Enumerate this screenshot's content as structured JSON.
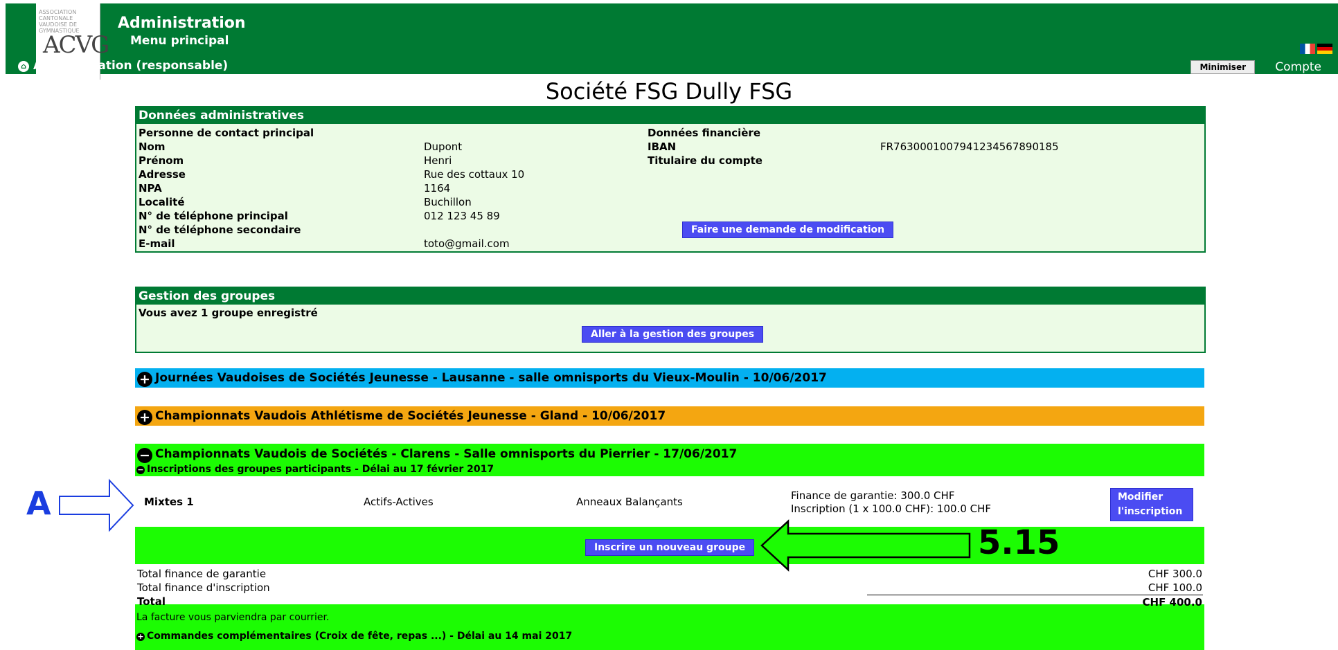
{
  "header": {
    "logo_text": "ACVG",
    "logo_small": "ASSOCIATION CANTONALE VAUDOISE DE GYMNASTIQUE",
    "title": "Administration",
    "subtitle": "Menu principal",
    "home_link": "Administration (responsable)",
    "minimize_label": "Minimiser",
    "account_label": "Compte"
  },
  "page_title": "Société FSG Dully FSG",
  "admin": {
    "heading": "Données administratives",
    "contact_heading": "Personne de contact principal",
    "fields": [
      {
        "label": "Nom",
        "value": "Dupont"
      },
      {
        "label": "Prénom",
        "value": "Henri"
      },
      {
        "label": "Adresse",
        "value": "Rue des cottaux 10"
      },
      {
        "label": "NPA",
        "value": "1164"
      },
      {
        "label": "Localité",
        "value": "Buchillon"
      },
      {
        "label": "N° de téléphone principal",
        "value": "012 123 45 89"
      },
      {
        "label": "N° de téléphone secondaire",
        "value": ""
      },
      {
        "label": "E-mail",
        "value": "toto@gmail.com"
      }
    ],
    "finance_heading": "Données financière",
    "iban_label": "IBAN",
    "iban_value": "FR7630001007941234567890185",
    "holder_label": "Titulaire du compte",
    "modify_button": "Faire une demande de modification"
  },
  "groups": {
    "heading": "Gestion des groupes",
    "count_text": "Vous avez 1 groupe enregistré",
    "button": "Aller à la gestion des groupes"
  },
  "events": [
    {
      "title": "Journées Vaudoises de Sociétés Jeunesse - Lausanne - salle omnisports du Vieux-Moulin - 10/06/2017",
      "color": "#04b0f0",
      "expanded": false
    },
    {
      "title": "Championnats Vaudois Athlétisme de Sociétés Jeunesse - Gland - 10/06/2017",
      "color": "#f4a611",
      "expanded": false
    },
    {
      "title": "Championnats Vaudois de Sociétés - Clarens - Salle omnisports du Pierrier - 17/06/2017",
      "color": "#1cfc03",
      "expanded": true
    }
  ],
  "registrations": {
    "heading": "Inscriptions des groupes participants - Délai au 17 février 2017",
    "entry": {
      "group": "Mixtes 1",
      "category": "Actifs-Actives",
      "discipline": "Anneaux Balançants",
      "guarantee": "Finance de garantie: 300.0 CHF",
      "inscription": "Inscription (1 x 100.0 CHF): 100.0 CHF",
      "modify_button": "Modifier l'inscription"
    },
    "new_group_button": "Inscrire un nouveau groupe"
  },
  "totals": {
    "guarantee_label": "Total finance de garantie",
    "guarantee_value": "CHF 300.0",
    "inscription_label": "Total finance d'inscription",
    "inscription_value": "CHF 100.0",
    "total_label": "Total",
    "total_value": "CHF 400.0"
  },
  "invoice_note": "La facture vous parviendra par courrier.",
  "extra_orders": "Commandes complémentaires (Croix de fête, repas ...) - Délai au 14 mai 2017",
  "annotations": {
    "letter": "A",
    "number": "5.15"
  }
}
